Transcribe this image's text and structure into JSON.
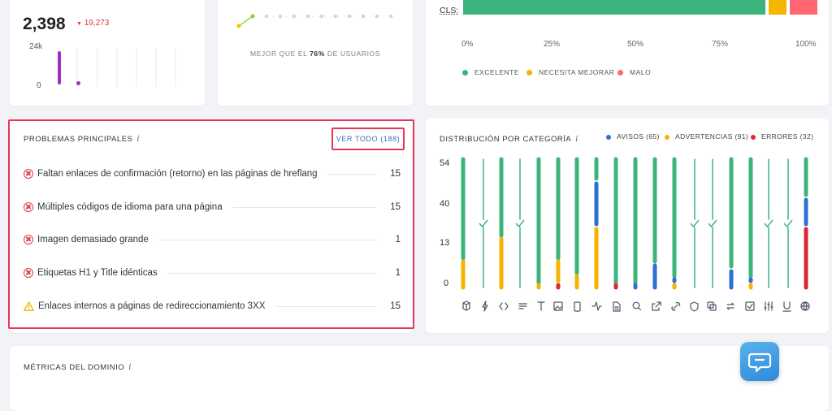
{
  "visits": {
    "value": "2,398",
    "delta_icon": "down-triangle-icon",
    "delta": "19,273",
    "y_top": "24k",
    "y_bottom": "0"
  },
  "score": {
    "better_prefix": "MEJOR QUE EL ",
    "better_pct": "76%",
    "better_suffix": " DE USUARIOS"
  },
  "cls": {
    "label": "CLS:",
    "segments": [
      {
        "status": "excellent",
        "fraction": 0.87,
        "color": "#3cb57c"
      },
      {
        "status": "needs_improvement",
        "fraction": 0.05,
        "color": "#f5b400"
      },
      {
        "status": "poor",
        "fraction": 0.08,
        "color": "#ff6672"
      }
    ],
    "ticks": [
      "0%",
      "25%",
      "50%",
      "75%",
      "100%"
    ],
    "legend": [
      {
        "label": "EXCELENTE",
        "color": "#3cb57c"
      },
      {
        "label": "NECESITA MEJORAR",
        "color": "#f5b400"
      },
      {
        "label": "MALO",
        "color": "#ff6672"
      }
    ]
  },
  "problems": {
    "title": "PROBLEMAS PRINCIPALES",
    "info": "i",
    "view_all": "VER TODO (188)",
    "items": [
      {
        "icon": "error-circle-icon",
        "text": "Faltan enlaces de confirmación (retorno) en las páginas de hreflang",
        "count": "15"
      },
      {
        "icon": "error-circle-icon",
        "text": "Múltiples códigos de idioma para una página",
        "count": "15"
      },
      {
        "icon": "error-circle-icon",
        "text": "Imagen demasiado grande",
        "count": "1"
      },
      {
        "icon": "error-circle-icon",
        "text": "Etiquetas H1 y Title idénticas",
        "count": "1"
      },
      {
        "icon": "warning-triangle-icon",
        "text": "Enlaces internos a páginas de redireccionamiento 3XX",
        "count": "15"
      }
    ]
  },
  "distribution": {
    "title": "DISTRIBUCIÓN POR CATEGORÍA",
    "info": "i",
    "legend": [
      {
        "label": "AVISOS (65)",
        "color": "#2f6fd6"
      },
      {
        "label": "ADVERTENCIAS (91)",
        "color": "#f5b400"
      },
      {
        "label": "ERRORES (32)",
        "color": "#d72a35"
      }
    ],
    "y_labels": [
      "54",
      "40",
      "13",
      "0"
    ],
    "colors": {
      "ok": "#3cb57c",
      "notice": "#2f6fd6",
      "warning": "#f5b400",
      "error": "#d72a35",
      "check": "#3cb57c"
    },
    "category_icons": [
      "cube-icon",
      "bolt-icon",
      "code-icon",
      "flow-icon",
      "text-icon",
      "image-icon",
      "mobile-icon",
      "pulse-icon",
      "document-icon",
      "search-icon",
      "external-link-icon",
      "link-icon",
      "shield-icon",
      "copy-icon",
      "redirect-icon",
      "checkbox-icon",
      "sliders-icon",
      "underline-icon",
      "globe-icon"
    ]
  },
  "metrics": {
    "title": "MÉTRICAS DEL DOMINIO",
    "info": "i"
  },
  "chat": {
    "icon": "chat-bubble-icon"
  }
}
